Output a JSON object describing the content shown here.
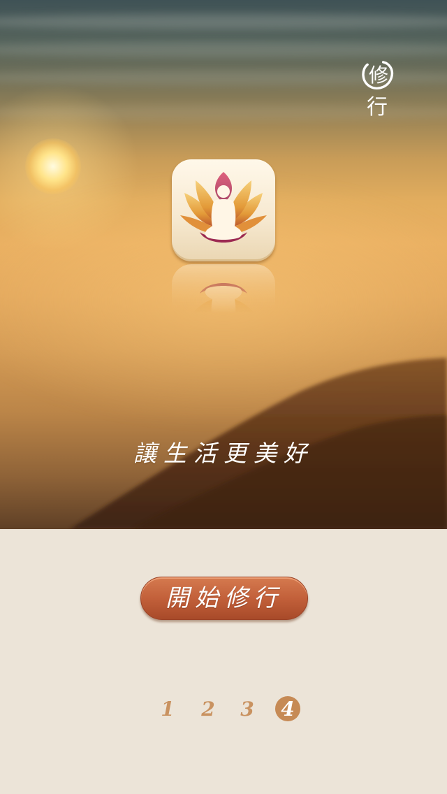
{
  "brand": {
    "top_char": "修",
    "bottom_char": "行"
  },
  "app_icon": {
    "name": "lotus-meditation-icon"
  },
  "slogan": "讓生活更美好",
  "start_button": {
    "label": "開始修行"
  },
  "pager": {
    "pages": [
      "1",
      "2",
      "3",
      "4"
    ],
    "current": "4"
  },
  "colors": {
    "button": "#c2603a",
    "pager_inactive": "#c99260",
    "pager_active_bg": "#c68a55",
    "bottom_background": "#ece4d8"
  }
}
